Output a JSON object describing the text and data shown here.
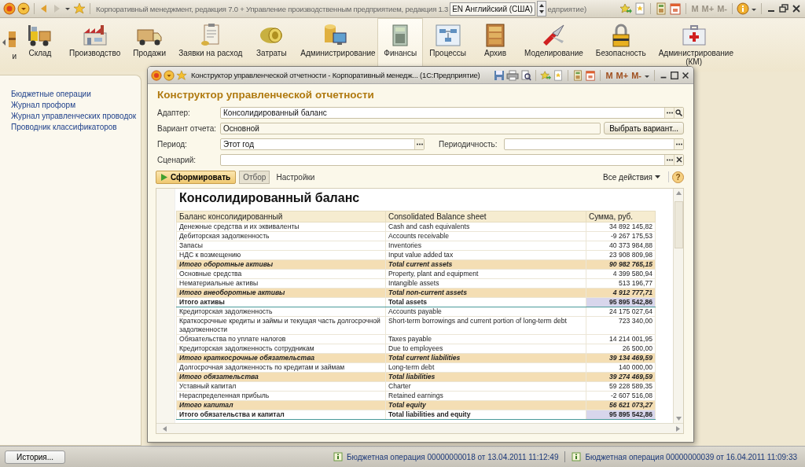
{
  "app_bar": {
    "title": "Корпоративный менеджмент, редакция 7.0 + Управление производственным предприятием, редакция 1.3",
    "language": "EN Английский (США)",
    "title_tail": "едприятие)",
    "memory_buttons": [
      {
        "label": "M",
        "disabled": true
      },
      {
        "label": "M+",
        "disabled": true
      },
      {
        "label": "M-",
        "disabled": true
      }
    ]
  },
  "sections": [
    {
      "label": "и",
      "selected": false
    },
    {
      "label": "Склад",
      "selected": false
    },
    {
      "label": "Производство",
      "selected": false
    },
    {
      "label": "Продажи",
      "selected": false
    },
    {
      "label": "Заявки на расход",
      "selected": false
    },
    {
      "label": "Затраты",
      "selected": false
    },
    {
      "label": "Администрирование",
      "selected": false
    },
    {
      "label": "Финансы",
      "selected": true
    },
    {
      "label": "Процессы",
      "selected": false
    },
    {
      "label": "Архив",
      "selected": false
    },
    {
      "label": "Моделирование",
      "selected": false
    },
    {
      "label": "Безопасность",
      "selected": false
    },
    {
      "label": "Администрирование (КМ)",
      "selected": false
    }
  ],
  "sidebar": {
    "items": [
      "Бюджетные операции",
      "Журнал проформ",
      "Журнал управленческих проводок",
      "Проводник классификаторов"
    ]
  },
  "dialog": {
    "title": "Конструктор управленческой отчетности - Корпоративный менедж... (1С:Предприятие)",
    "memory_buttons": [
      {
        "label": "M",
        "disabled": false
      },
      {
        "label": "M+",
        "disabled": false
      },
      {
        "label": "M-",
        "disabled": false
      }
    ],
    "heading": "Конструктор управленческой отчетности",
    "adapter": {
      "label": "Адаптер:",
      "value": "Консолидированный баланс"
    },
    "variant": {
      "label": "Вариант отчета:",
      "value": "Основной",
      "button": "Выбрать вариант..."
    },
    "period": {
      "label": "Период:",
      "value": "Этот год"
    },
    "periodicity": {
      "label": "Периодичность:"
    },
    "scenario": {
      "label": "Сценарий:"
    },
    "toolbar": {
      "generate": "Сформировать",
      "filter": {
        "label": "Отбор",
        "selected": true
      },
      "settings": "Настройки",
      "all_actions": "Все действия",
      "help": "?"
    },
    "report": {
      "title": "Консолидированный баланс",
      "columns": [
        "Баланс консолидированный",
        "Consolidated Balance sheet",
        "Сумма, руб."
      ],
      "rows": [
        {
          "kind": "item",
          "cells": [
            "Денежные средства и их эквиваленты",
            "Cash and cash equivalents",
            "34 892 145,82"
          ]
        },
        {
          "kind": "item",
          "cells": [
            "Дебиторская задолженность",
            "Accounts receivable",
            "-9 267 175,53"
          ]
        },
        {
          "kind": "item",
          "cells": [
            "Запасы",
            "Inventories",
            "40 373 984,88"
          ]
        },
        {
          "kind": "item",
          "cells": [
            "НДС к возмещению",
            "Input value added tax",
            "23 908 809,98"
          ]
        },
        {
          "kind": "subtotal",
          "cells": [
            "Итого оборотные активы",
            "Total current assets",
            "90 982 765,15"
          ]
        },
        {
          "kind": "item",
          "cells": [
            "Основные средства",
            "Property, plant and equipment",
            "4 399 580,94"
          ]
        },
        {
          "kind": "item",
          "cells": [
            "Нематериальные активы",
            "Intangible assets",
            "513 196,77"
          ]
        },
        {
          "kind": "subtotal",
          "cells": [
            "Итого внеоборотные активы",
            "Total non-current assets",
            "4 912 777,71"
          ]
        },
        {
          "kind": "total",
          "cells": [
            "Итого активы",
            "Total assets",
            "95 895 542,86"
          ]
        },
        {
          "kind": "item",
          "cells": [
            "Кредиторская задолженность",
            "Accounts payable",
            "24 175 027,64"
          ]
        },
        {
          "kind": "item",
          "cells": [
            "Краткосрочные кредиты и займы и текущая часть долгосрочной задолженности",
            "Short-term borrowings and current portion of long-term debt",
            "723 340,00"
          ]
        },
        {
          "kind": "item",
          "cells": [
            "Обязательства по уплате налогов",
            "Taxes payable",
            "14 214 001,95"
          ]
        },
        {
          "kind": "item",
          "cells": [
            "Кредиторская задолженность сотрудникам",
            "Due to employees",
            "26 500,00"
          ]
        },
        {
          "kind": "subtotal",
          "cells": [
            "Итого краткосрочные обязательства",
            "Total current liabilities",
            "39 134 469,59"
          ]
        },
        {
          "kind": "item",
          "cells": [
            "Долгосрочная задолженность по кредитам и займам",
            "Long-term debt",
            "140 000,00"
          ]
        },
        {
          "kind": "subtotal",
          "cells": [
            "Итого обязательства",
            "Total liabilities",
            "39 274 469,59"
          ]
        },
        {
          "kind": "item",
          "cells": [
            "Уставный капитал",
            "Charter",
            "59 228 589,35"
          ]
        },
        {
          "kind": "item",
          "cells": [
            "Нераспределенная прибыль",
            "Retained earnings",
            "-2 607 516,08"
          ]
        },
        {
          "kind": "subtotal",
          "cells": [
            "Итого капитал",
            "Total equity",
            "56 621 073,27"
          ]
        },
        {
          "kind": "total",
          "cells": [
            "Итого обязательства и капитал",
            "Total liabilities and equity",
            "95 895 542,86"
          ]
        }
      ]
    }
  },
  "status_bar": {
    "history_button": "История...",
    "messages": [
      "Бюджетная операция 00000000018 от 13.04.2011 11:12:49",
      "Бюджетная операция 00000000039 от 16.04.2011 11:09:33"
    ]
  }
}
